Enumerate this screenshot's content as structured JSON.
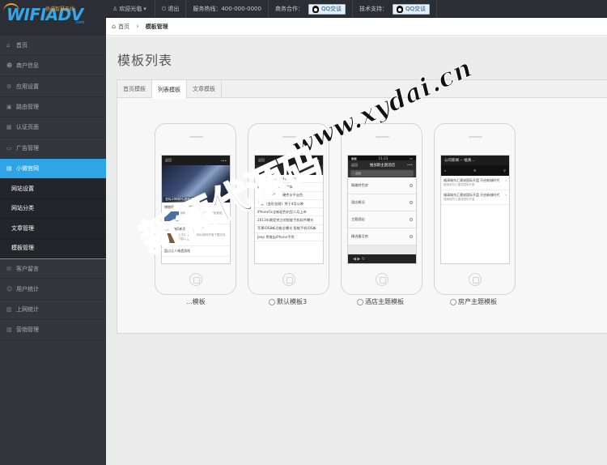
{
  "brand": {
    "logo_text": "WIFIADV",
    "slogan": "协成智慧无线",
    "domain_suffix": ".com"
  },
  "topnav": {
    "welcome": "欢迎光临",
    "logout": "退出",
    "hotline": "服务热线：400-000-0000",
    "cooperation": "商务合作：",
    "qq_label_1": "QQ交谈",
    "support": "技术支持：",
    "qq_label_2": "QQ交谈"
  },
  "sidebar": {
    "items": [
      {
        "label": "首页",
        "icon": "home-icon"
      },
      {
        "label": "商户信息",
        "icon": "users-icon"
      },
      {
        "label": "应用设置",
        "icon": "gear-icon"
      },
      {
        "label": "路由管理",
        "icon": "router-icon"
      },
      {
        "label": "认证页面",
        "icon": "grid-icon"
      },
      {
        "label": "广告管理",
        "icon": "ad-icon"
      },
      {
        "label": "小微官网",
        "icon": "web-icon"
      }
    ],
    "sub_items": [
      {
        "label": "网站设置"
      },
      {
        "label": "网站分类"
      },
      {
        "label": "文章管理"
      },
      {
        "label": "模板管理"
      }
    ],
    "items_after": [
      {
        "label": "客户留言",
        "icon": "message-icon"
      },
      {
        "label": "用户统计",
        "icon": "user-stats-icon"
      },
      {
        "label": "上网统计",
        "icon": "chart-icon"
      },
      {
        "label": "营销管理",
        "icon": "marketing-icon"
      }
    ]
  },
  "breadcrumb": {
    "home": "首页",
    "current": "模板管理"
  },
  "page_title": "模板列表",
  "tabs": [
    {
      "label": "首页模板"
    },
    {
      "label": "列表模板"
    },
    {
      "label": "文章模板"
    }
  ],
  "templates": [
    {
      "label": "...模板",
      "header_left": "返回",
      "caption": "坐标1986PC游戏发布!",
      "news": [
        "博物馆5月发布5月推新游",
        "上古卷轴5新资料片即将开放",
        "盘点让人难遗游戏"
      ],
      "news_sub": [
        "博物馆5月发布特有的卡牌及竞技关卡",
        "上古卷轴5新资料片即将开放下载文件内容丰富"
      ]
    },
    {
      "label": "默认模板3",
      "header_left": "返回",
      "header_title": "我的",
      "rows": [
        "热门iPad外观蓝牙键盘推荐",
        "最好的信仰Win8触控本PK",
        "nubia Z5评测：硬件水平出色",
        "电影《变形金刚》将于4月公映",
        "iPhone5s全新配色机型二月上市",
        "2013年最受关注的智能手机软件曝光",
        "苹果iOS8新功能全曝光 智能手机iOS新",
        "Jeep 将推出iPhone手壳"
      ]
    },
    {
      "label": "酒店主题模板",
      "status_time": "11:23",
      "header_title": "维加斯主题酒店",
      "back_label": "返回",
      "rows": [
        "情趣特色房",
        "酒店概况",
        "主题酒店",
        "精选蜜月房"
      ]
    },
    {
      "label": "房产主题模板",
      "header_title": "公司新闻 -- 福清...",
      "news": [
        "福清城东汇建成国际开盘 开启新城时代",
        "福清城东汇建成国际开盘 开启新城时代"
      ],
      "news_sub": [
        "福清城东汇建成国际开盘",
        "福清城东汇建成国际开盘"
      ]
    }
  ],
  "watermark": {
    "url": "www.xydai.cn",
    "text": "新源代源码"
  }
}
